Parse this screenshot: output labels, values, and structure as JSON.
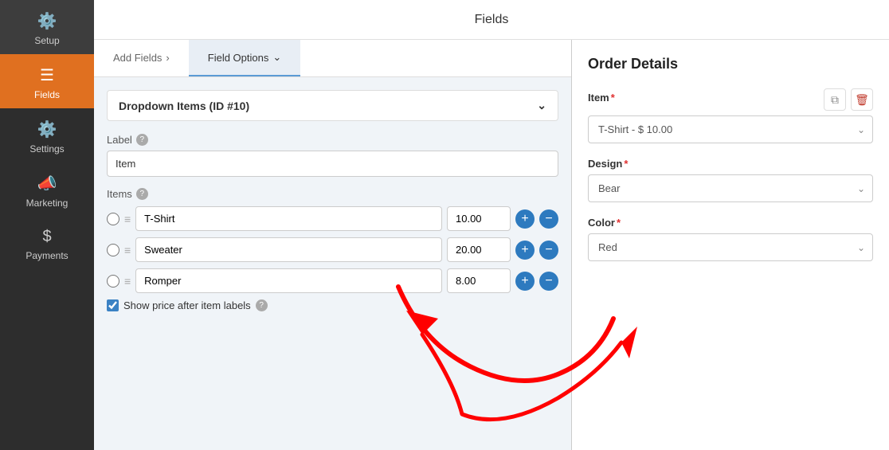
{
  "header": {
    "title": "Fields"
  },
  "sidebar": {
    "items": [
      {
        "id": "setup",
        "label": "Setup",
        "icon": "⚙️",
        "active": false
      },
      {
        "id": "fields",
        "label": "Fields",
        "icon": "📋",
        "active": true
      },
      {
        "id": "settings",
        "label": "Settings",
        "icon": "⚙️",
        "active": false
      },
      {
        "id": "marketing",
        "label": "Marketing",
        "icon": "📣",
        "active": false
      },
      {
        "id": "payments",
        "label": "Payments",
        "icon": "💲",
        "active": false
      }
    ]
  },
  "tabs": [
    {
      "id": "add-fields",
      "label": "Add Fields",
      "active": false,
      "chevron": "›"
    },
    {
      "id": "field-options",
      "label": "Field Options",
      "active": true,
      "chevron": "⌄"
    }
  ],
  "field_options": {
    "dropdown_items_label": "Dropdown Items (ID #10)",
    "label_field": {
      "label": "Label",
      "value": "Item"
    },
    "items_label": "Items",
    "items": [
      {
        "name": "T-Shirt",
        "price": "10.00"
      },
      {
        "name": "Sweater",
        "price": "20.00"
      },
      {
        "name": "Romper",
        "price": "8.00"
      }
    ],
    "show_price_label": "Show price after item labels"
  },
  "order_details": {
    "title": "Order Details",
    "fields": [
      {
        "id": "item",
        "label": "Item",
        "required": true,
        "value": "T-Shirt - $ 10.00",
        "type": "select"
      },
      {
        "id": "design",
        "label": "Design",
        "required": true,
        "value": "Bear",
        "type": "select"
      },
      {
        "id": "color",
        "label": "Color",
        "required": true,
        "value": "Red",
        "type": "select"
      }
    ]
  },
  "icons": {
    "copy": "⧉",
    "trash": "🗑",
    "chevron_down": "⌄",
    "chevron_right": "›",
    "drag": "≡",
    "plus": "+",
    "minus": "−",
    "check": "✓"
  }
}
